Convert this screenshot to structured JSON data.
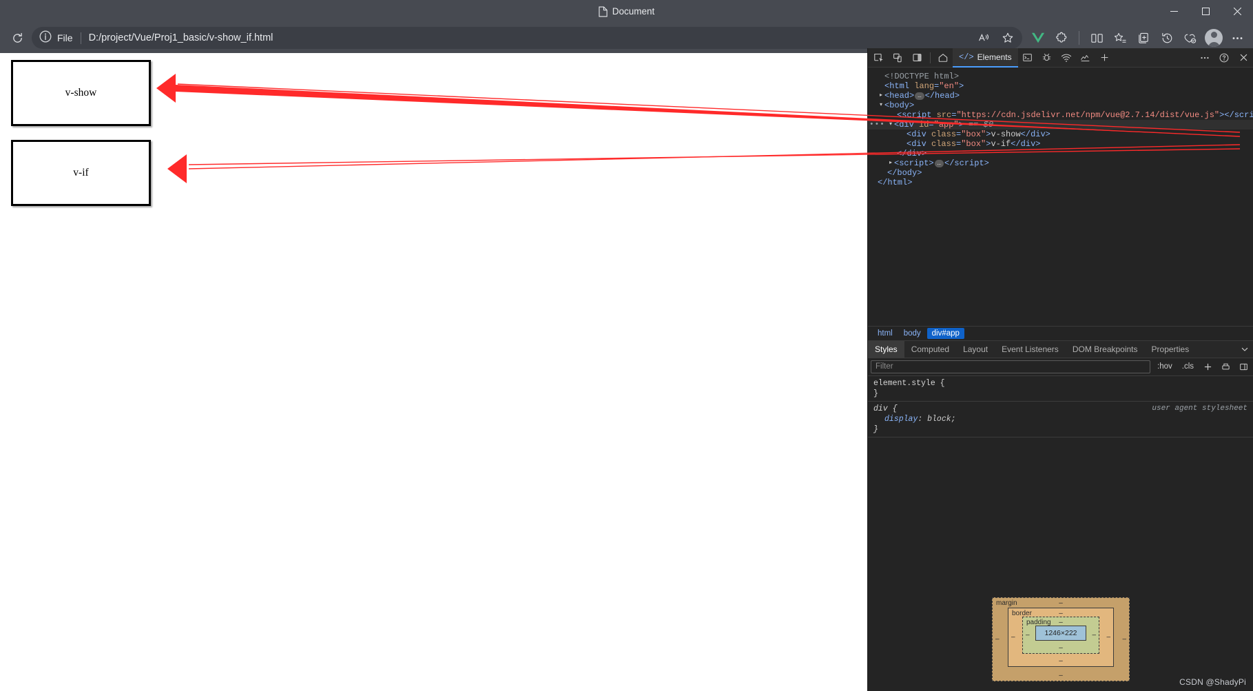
{
  "window": {
    "tab_title": "Document",
    "minimize": "–",
    "maximize": "□",
    "close": "✕"
  },
  "toolbar": {
    "reload_icon": "reload-icon",
    "info_icon": "info-circle-icon",
    "file_label": "File",
    "url": "D:/project/Vue/Proj1_basic/v-show_if.html",
    "read_aloud_icon": "read-aloud-icon",
    "favorite_icon": "star-outline-icon",
    "vue_devtools_icon": "vue-logo-icon",
    "extensions_icon": "puzzle-piece-icon",
    "split_screen_icon": "split-screen-icon",
    "favorites_icon": "favorites-star-list-icon",
    "collections_icon": "collections-icon",
    "history_icon": "history-clock-icon",
    "browser_essentials_icon": "browser-essentials-icon",
    "profile_icon": "profile-avatar-icon",
    "settings_more_icon": "ellipsis-horizontal-icon"
  },
  "page": {
    "boxes": [
      {
        "label": "v-show"
      },
      {
        "label": "v-if"
      }
    ]
  },
  "annotations": {
    "arrow_color": "#ff2a2a",
    "arrows": [
      {
        "from": "dom-node-v-show",
        "to": "page-box-v-show"
      },
      {
        "from": "dom-node-v-if",
        "to": "page-box-v-if"
      }
    ]
  },
  "devtools": {
    "toolbar": {
      "inspect_icon": "inspect-element-icon",
      "device_toolbar_icon": "device-toolbar-icon",
      "dock_side_icon": "dock-side-icon",
      "home_icon": "home-icon",
      "console_icon": "console-icon",
      "sources_icon": "bug-sources-icon",
      "network_icon": "network-wifi-icon",
      "performance_icon": "performance-icon",
      "add_tab_icon": "add-panel-plus-icon",
      "more_icon": "ellipsis-horizontal-icon",
      "help_icon": "help-question-icon",
      "close_icon": "close-x-icon",
      "active_tab": "Elements",
      "elements_tab_glyph": "</>"
    },
    "dom_tree": [
      {
        "indent": 0,
        "tri": "none",
        "html": "doctype"
      },
      {
        "indent": 0,
        "tri": "none",
        "html": "html-open"
      },
      {
        "indent": 1,
        "tri": "right",
        "html": "head-collapsed"
      },
      {
        "indent": 1,
        "tri": "down",
        "html": "body-open"
      },
      {
        "indent": 2,
        "tri": "none",
        "html": "script-src"
      },
      {
        "indent": 1,
        "tri": "down",
        "html": "div-app",
        "selected": true
      },
      {
        "indent": 3,
        "tri": "none",
        "html": "div-box-vshow"
      },
      {
        "indent": 3,
        "tri": "none",
        "html": "div-box-vif"
      },
      {
        "indent": 2,
        "tri": "none",
        "html": "div-close"
      },
      {
        "indent": 1,
        "tri": "right",
        "html": "script-collapsed"
      },
      {
        "indent": 1,
        "tri": "none",
        "html": "body-close"
      },
      {
        "indent": 0,
        "tri": "none",
        "html": "html-close"
      }
    ],
    "dom_text": {
      "doctype": "<!DOCTYPE html>",
      "html_open_tag": "<html",
      "html_lang_attr": "lang",
      "html_lang_value": "\"en\"",
      "head_open": "<head>",
      "head_close": "</head>",
      "body_open": "<body>",
      "body_close": "</body>",
      "script_open": "<script",
      "script_src_attr": "src",
      "script_src_value": "\"https://cdn.jsdelivr.net/npm/vue@2.7.14/dist/vue.js\"",
      "script_close": "</script>",
      "div_open": "<div",
      "div_id_attr": "id",
      "div_id_value": "\"app\"",
      "div_selected_marker": "== $0",
      "div_class_attr": "class",
      "div_class_value": "\"box\"",
      "box_vshow_text": "v-show",
      "box_vif_text": "v-if",
      "div_close": "</div>",
      "html_close": "</html>",
      "gt": ">",
      "ellipsis_badge": "…"
    },
    "breadcrumb": [
      {
        "label": "html",
        "active": false
      },
      {
        "label": "body",
        "active": false
      },
      {
        "label": "div#app",
        "active": true
      }
    ],
    "sidebar_tabs": [
      {
        "label": "Styles",
        "active": true
      },
      {
        "label": "Computed",
        "active": false
      },
      {
        "label": "Layout",
        "active": false
      },
      {
        "label": "Event Listeners",
        "active": false
      },
      {
        "label": "DOM Breakpoints",
        "active": false
      },
      {
        "label": "Properties",
        "active": false
      }
    ],
    "filter": {
      "placeholder": "Filter",
      "value": "",
      "hov_label": ":hov",
      "cls_label": ".cls",
      "new_rule_icon": "plus-icon",
      "print_media_icon": "print-preview-icon",
      "computed_sidebar_icon": "sidebar-toggle-icon"
    },
    "styles_rules": [
      {
        "selector": "element.style {",
        "close": "}",
        "origin": "",
        "ua": false,
        "declarations": []
      },
      {
        "selector": "div {",
        "close": "}",
        "origin": "user agent stylesheet",
        "ua": true,
        "declarations": [
          {
            "property": "display",
            "value": "block;"
          }
        ]
      }
    ],
    "box_model": {
      "margin_label": "margin",
      "margin_top": "–",
      "margin_bottom": "–",
      "margin_left": "–",
      "margin_right": "–",
      "border_label": "border",
      "border_top": "–",
      "border_bottom": "–",
      "border_left": "–",
      "border_right": "–",
      "padding_label": "padding",
      "padding_top": "–",
      "padding_bottom": "–",
      "padding_left": "–",
      "padding_right": "–",
      "content_size": "1246×222"
    }
  },
  "watermark": "CSDN @ShadyPi",
  "colors": {
    "chrome_bg": "#474a51",
    "devtools_bg": "#242424",
    "accent_blue": "#4a9eff",
    "tag_blue": "#8ab4f8",
    "attr_orange": "#d1a679",
    "value_red": "#f28b82",
    "arrow_red": "#ff2a2a",
    "vue_green": "#42b883"
  }
}
